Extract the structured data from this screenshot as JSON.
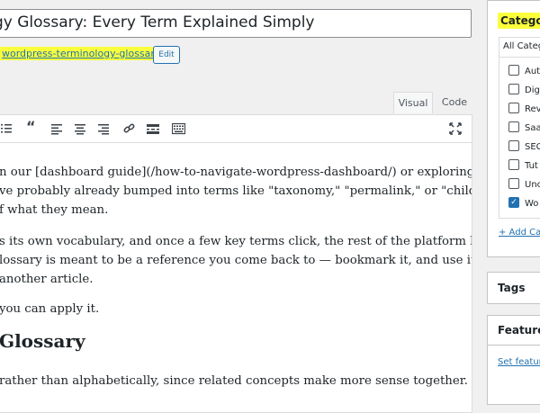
{
  "post": {
    "title": "gy Glossary: Every Term Explained Simply",
    "permalink_slug": "wordpress-terminology-glossary/",
    "edit_label": "Edit"
  },
  "editor": {
    "tabs": [
      "Visual",
      "Code"
    ],
    "paragraphs": [
      "n our [dashboard guide](/how-to-navigate-wordpress-dashboard/) or exploring",
      "ve probably already bumped into terms like \"taxonomy,\" \"permalink,\" or \"child theme\"",
      "f what they mean.",
      "s its own vocabulary, and once a few key terms click, the rest of the platform becomes",
      "lossary is meant to be a reference you come back to — bookmark it, and use it whenever",
      "another article.",
      "you can apply it."
    ],
    "heading": "Glossary",
    "last_line": "rather than alphabetically, since related concepts make more sense together. If you're"
  },
  "sidebar": {
    "categories_title": "Categorie",
    "all_categories_tab": "All Categ",
    "categories": [
      {
        "label": "Aut",
        "checked": false
      },
      {
        "label": "Dig",
        "checked": false
      },
      {
        "label": "Rev",
        "checked": false
      },
      {
        "label": "Saa",
        "checked": false
      },
      {
        "label": "SEC",
        "checked": false
      },
      {
        "label": "Tut",
        "checked": false
      },
      {
        "label": "Unc",
        "checked": false
      },
      {
        "label": "Wo",
        "checked": true
      }
    ],
    "add_category": "+ Add Ca",
    "tags_title": "Tags",
    "featured_title": "Featured",
    "set_featured": "Set featur"
  }
}
